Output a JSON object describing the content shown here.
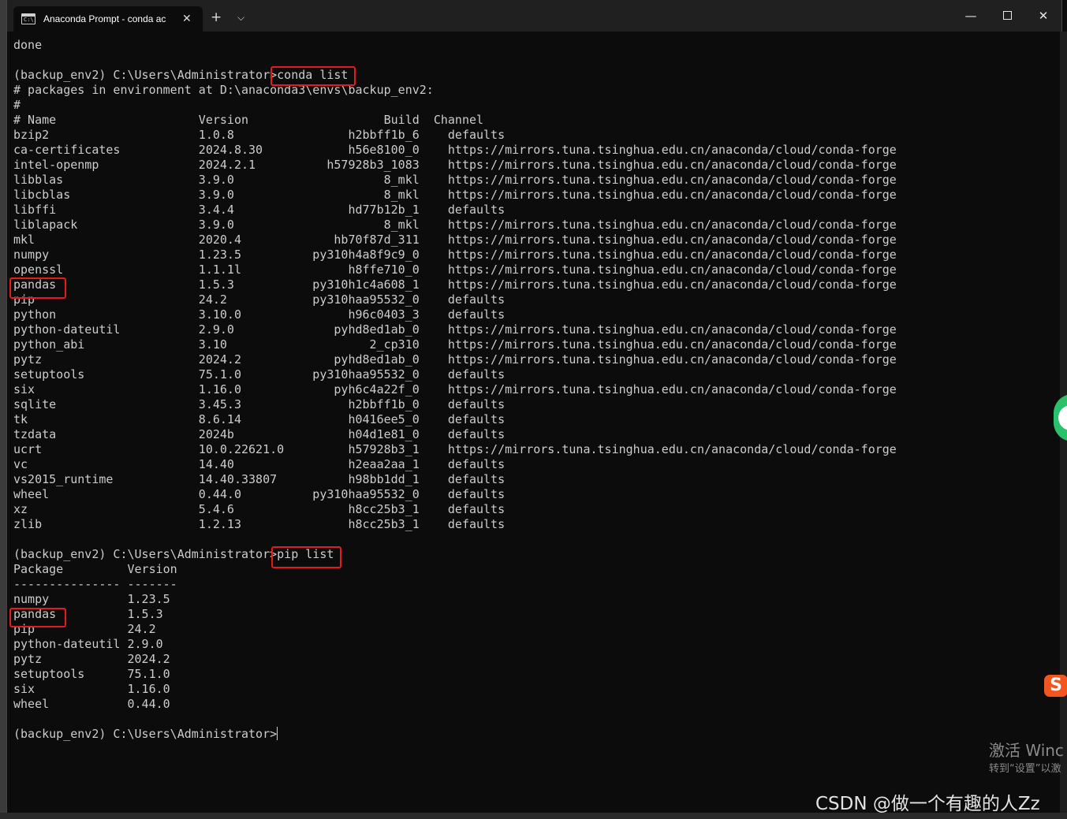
{
  "window": {
    "tab_title": "Anaconda Prompt - conda ac",
    "tab_icon_text": "C:\\",
    "close_tab": "✕",
    "new_tab": "+",
    "dropdown": "⌵",
    "minimize": "—",
    "close": "✕"
  },
  "terminal": {
    "lines": [
      "done",
      "",
      "(backup_env2) C:\\Users\\Administrator>conda list",
      "# packages in environment at D:\\anaconda3\\envs\\backup_env2:",
      "#",
      "# Name                    Version                   Build  Channel",
      "bzip2                     1.0.8                h2bbff1b_6    defaults",
      "ca-certificates           2024.8.30            h56e8100_0    https://mirrors.tuna.tsinghua.edu.cn/anaconda/cloud/conda-forge",
      "intel-openmp              2024.2.1          h57928b3_1083    https://mirrors.tuna.tsinghua.edu.cn/anaconda/cloud/conda-forge",
      "libblas                   3.9.0                     8_mkl    https://mirrors.tuna.tsinghua.edu.cn/anaconda/cloud/conda-forge",
      "libcblas                  3.9.0                     8_mkl    https://mirrors.tuna.tsinghua.edu.cn/anaconda/cloud/conda-forge",
      "libffi                    3.4.4                hd77b12b_1    defaults",
      "liblapack                 3.9.0                     8_mkl    https://mirrors.tuna.tsinghua.edu.cn/anaconda/cloud/conda-forge",
      "mkl                       2020.4             hb70f87d_311    https://mirrors.tuna.tsinghua.edu.cn/anaconda/cloud/conda-forge",
      "numpy                     1.23.5          py310h4a8f9c9_0    https://mirrors.tuna.tsinghua.edu.cn/anaconda/cloud/conda-forge",
      "openssl                   1.1.1l               h8ffe710_0    https://mirrors.tuna.tsinghua.edu.cn/anaconda/cloud/conda-forge",
      "pandas                    1.5.3           py310h1c4a608_1    https://mirrors.tuna.tsinghua.edu.cn/anaconda/cloud/conda-forge",
      "pip                       24.2            py310haa95532_0    defaults",
      "python                    3.10.0               h96c0403_3    defaults",
      "python-dateutil           2.9.0              pyhd8ed1ab_0    https://mirrors.tuna.tsinghua.edu.cn/anaconda/cloud/conda-forge",
      "python_abi                3.10                    2_cp310    https://mirrors.tuna.tsinghua.edu.cn/anaconda/cloud/conda-forge",
      "pytz                      2024.2             pyhd8ed1ab_0    https://mirrors.tuna.tsinghua.edu.cn/anaconda/cloud/conda-forge",
      "setuptools                75.1.0          py310haa95532_0    defaults",
      "six                       1.16.0             pyh6c4a22f_0    https://mirrors.tuna.tsinghua.edu.cn/anaconda/cloud/conda-forge",
      "sqlite                    3.45.3               h2bbff1b_0    defaults",
      "tk                        8.6.14               h0416ee5_0    defaults",
      "tzdata                    2024b                h04d1e81_0    defaults",
      "ucrt                      10.0.22621.0         h57928b3_1    https://mirrors.tuna.tsinghua.edu.cn/anaconda/cloud/conda-forge",
      "vc                        14.40                h2eaa2aa_1    defaults",
      "vs2015_runtime            14.40.33807          h98bb1dd_1    defaults",
      "wheel                     0.44.0          py310haa95532_0    defaults",
      "xz                        5.4.6                h8cc25b3_1    defaults",
      "zlib                      1.2.13               h8cc25b3_1    defaults",
      "",
      "(backup_env2) C:\\Users\\Administrator>pip list",
      "Package         Version",
      "--------------- -------",
      "numpy           1.23.5",
      "pandas          1.5.3",
      "pip             24.2",
      "python-dateutil 2.9.0",
      "pytz            2024.2",
      "setuptools      75.1.0",
      "six             1.16.0",
      "wheel           0.44.0",
      "",
      "(backup_env2) C:\\Users\\Administrator>"
    ]
  },
  "overlay": {
    "activate_windows": "激活 Winc",
    "activate_sub": "转到“设置”以激",
    "csdn_watermark": "CSDN @做一个有趣的人Zz",
    "sogou": "S"
  },
  "colors": {
    "terminal_bg": "#0c0c0c",
    "terminal_fg": "#cccccc",
    "highlight": "#e31b1b",
    "titlebar": "#202020"
  }
}
